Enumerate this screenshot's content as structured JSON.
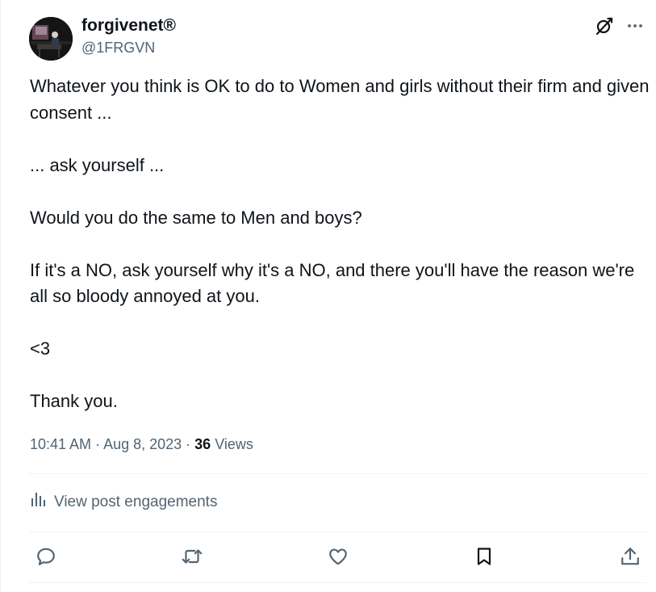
{
  "author": {
    "name": "forgivenet®",
    "handle": "@1FRGVN"
  },
  "tweet": {
    "paragraphs": [
      "Whatever you think is OK to do to Women and girls without their firm and given consent ...",
      "... ask yourself ...",
      "Would you do the same to Men and boys?",
      "If it's a NO, ask yourself why it's a NO, and there you'll have the reason we're all so bloody annoyed at you.",
      "<3",
      "Thank you."
    ]
  },
  "meta": {
    "time": "10:41 AM",
    "separator": " · ",
    "date": "Aug 8, 2023",
    "views_count": "36",
    "views_label": "Views"
  },
  "engagements": {
    "label": "View post engagements"
  },
  "icons": {
    "grok": "grok-icon",
    "more": "more-icon",
    "analytics": "analytics-icon",
    "reply": "reply-icon",
    "repost": "repost-icon",
    "like": "like-icon",
    "bookmark": "bookmark-icon",
    "share": "share-icon"
  },
  "colors": {
    "text": "#0f1419",
    "secondary": "#536471",
    "border": "#eff3f4"
  }
}
